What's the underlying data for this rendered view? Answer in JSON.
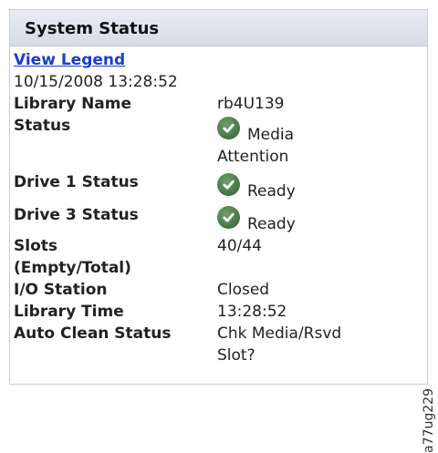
{
  "header": {
    "title": "System Status"
  },
  "legend_link": "View Legend",
  "timestamp": "10/15/2008 13:28:52",
  "rows": {
    "library_name": {
      "label": "Library Name",
      "value": "rb4U139"
    },
    "status": {
      "label": "Status",
      "value_line1": "Media",
      "value_line2": "Attention",
      "icon": "check-circle-icon"
    },
    "drive1": {
      "label": "Drive 1 Status",
      "value": "Ready",
      "icon": "check-circle-icon"
    },
    "drive3": {
      "label": "Drive 3 Status",
      "value": "Ready",
      "icon": "check-circle-icon"
    },
    "slots": {
      "label_line1": "Slots",
      "label_line2": "(Empty/Total)",
      "value": "40/44"
    },
    "io_station": {
      "label": "I/O Station",
      "value": "Closed"
    },
    "library_time": {
      "label": "Library Time",
      "value": "13:28:52"
    },
    "auto_clean": {
      "label": "Auto Clean Status",
      "value_line1": "Chk Media/Rsvd",
      "value_line2": "Slot?"
    }
  },
  "figure_id": "a77ug229",
  "colors": {
    "link": "#1a3fc8",
    "header_bg": "#dde1ea",
    "ok_icon": "#3e6f40"
  }
}
